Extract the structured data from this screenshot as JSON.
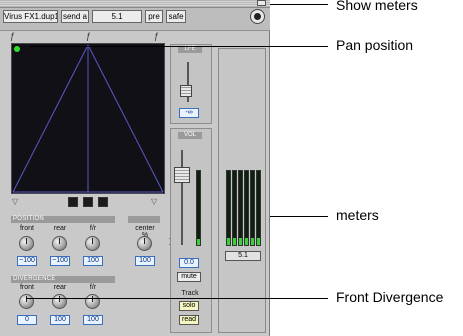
{
  "header": {
    "track": "Virus FX1.dup1",
    "send": "send a",
    "preset": "5.1",
    "pre": "pre",
    "safe": "safe"
  },
  "pan_field": {
    "marks": [
      "ƒ",
      "ƒ",
      "ƒ"
    ]
  },
  "lfe": {
    "label": "LFE",
    "value": "-∞"
  },
  "position": {
    "title": "POSITION",
    "knobs": [
      {
        "label": "front",
        "value": "−100"
      },
      {
        "label": "rear",
        "value": "−100"
      },
      {
        "label": "f/r",
        "value": "100"
      }
    ],
    "center": {
      "label": "center %",
      "value": "100"
    }
  },
  "divergence": {
    "title": "DIVERGENCE",
    "knobs": [
      {
        "label": "front",
        "value": "0"
      },
      {
        "label": "rear",
        "value": "100"
      },
      {
        "label": "f/r",
        "value": "100"
      }
    ]
  },
  "volume": {
    "label": "VOL",
    "value": "0.0",
    "mute": "mute"
  },
  "track": {
    "label": "Track",
    "solo": "solo",
    "read": "read"
  },
  "meters": {
    "format": "5.1"
  },
  "callouts": {
    "show_meters": "Show meters",
    "pan_position": "Pan position",
    "meters": "meters",
    "front_divergence": "Front Divergence"
  },
  "colors": {
    "pan_bg": "#101016",
    "pan_lines": "#5a58c8",
    "pan_dot": "#2ee02e",
    "meter_green": "#3ccf3c",
    "value_text": "#0a2f7a"
  }
}
